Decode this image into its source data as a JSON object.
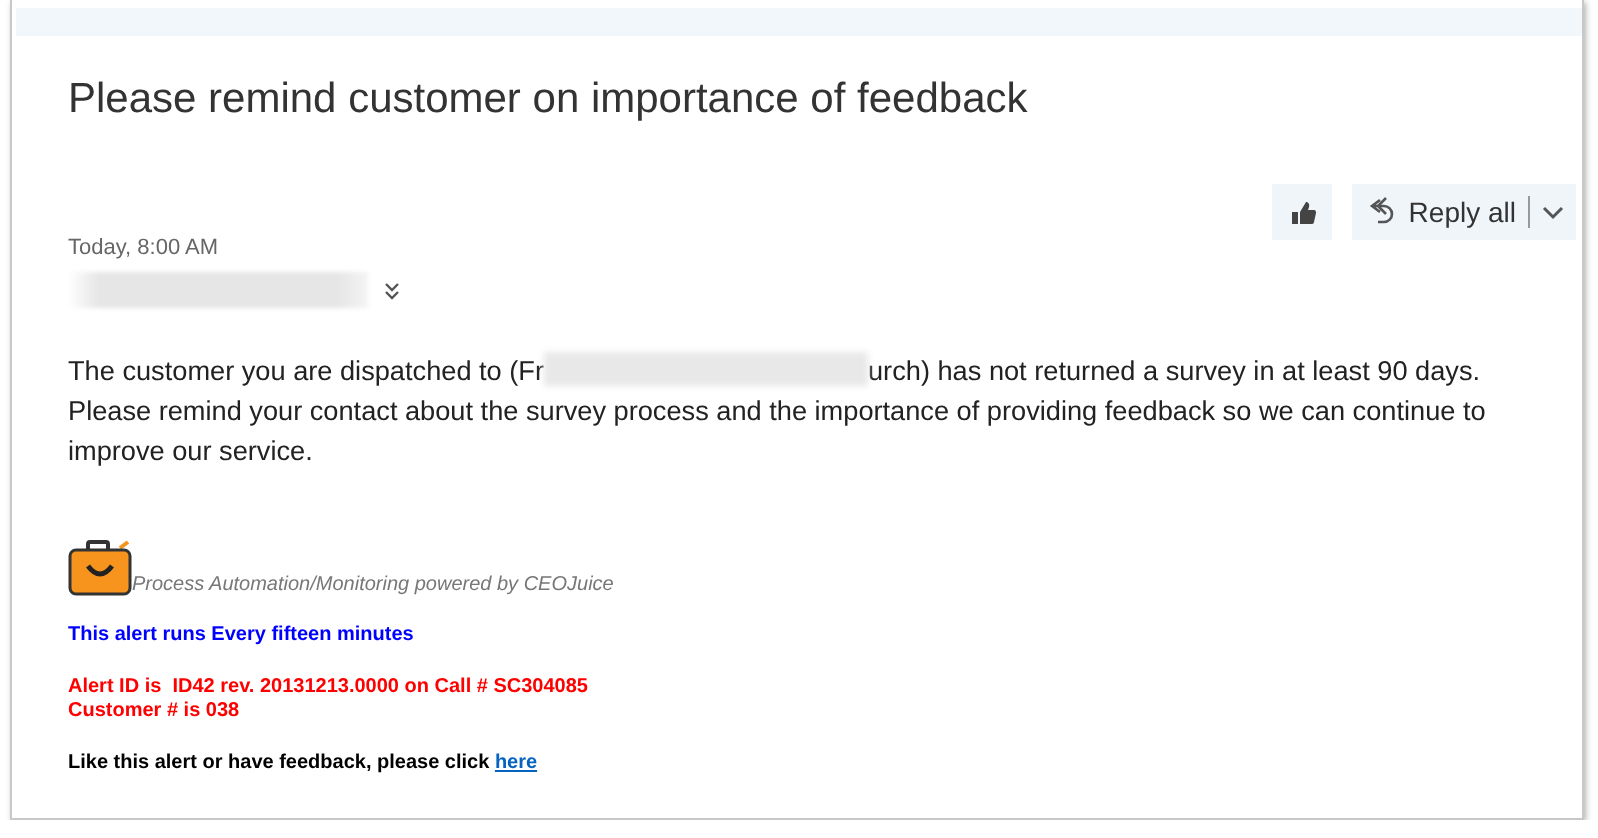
{
  "message": {
    "subject": "Please remind customer on importance of feedback",
    "date": "Today, 8:00 AM",
    "actions": [
      {
        "kind": "like"
      },
      {
        "kind": "reply",
        "label": "Reply all"
      }
    ],
    "body": {
      "before": "The customer you are dispatched to (Fr",
      "after": "urch) has not returned a survey in at least 90 days. Please remind your contact about the survey process and the importance of providing feedback so we can continue to improve our service."
    },
    "signature": {
      "powered_by": "Process Automation/Monitoring powered by CEOJuice"
    },
    "alert_lines": [
      {
        "text": "This alert runs Every fifteen minutes",
        "color": "#0000ff"
      },
      {
        "text": "Alert ID is  ID42 rev. 20131213.0000 on Call # SC304085\nCustomer # is 038",
        "color": "#ff0000"
      }
    ],
    "feedback": {
      "text": "Like this alert or have feedback, please click ",
      "link": "here"
    }
  }
}
